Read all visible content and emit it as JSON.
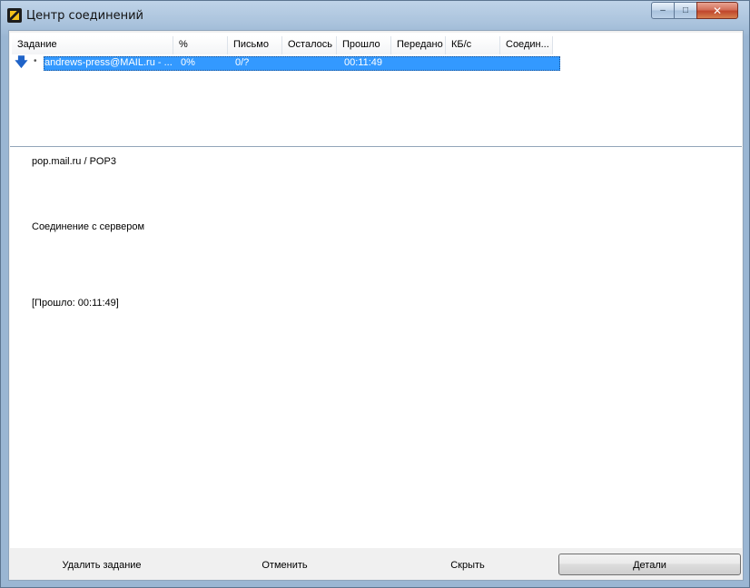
{
  "window": {
    "title": "Центр соединений"
  },
  "controls": {
    "minimize": "–",
    "maximize": "□",
    "close": "✕"
  },
  "columns": [
    {
      "label": "Задание"
    },
    {
      "label": "%"
    },
    {
      "label": "Письмо"
    },
    {
      "label": "Осталось"
    },
    {
      "label": "Прошло"
    },
    {
      "label": "Передано"
    },
    {
      "label": "КБ/с"
    },
    {
      "label": "Соедин..."
    }
  ],
  "rows": [
    {
      "icon": "download-arrow-icon",
      "task": "andrews-press@MAIL.ru - ...",
      "percent": "0%",
      "letter": "0/?",
      "remaining": "",
      "elapsed": "00:11:49",
      "transferred": "",
      "speed": "",
      "connection": ""
    }
  ],
  "details": {
    "server": "pop.mail.ru / POP3",
    "status": "Соединение с сервером",
    "elapsed_line": "[Прошло: 00:11:49]"
  },
  "buttons": {
    "delete_task": "Удалить задание",
    "cancel": "Отменить",
    "hide": "Скрыть",
    "details": "Детали"
  },
  "colors": {
    "selection": "#3399ff",
    "frame": "#9ab6d3"
  }
}
